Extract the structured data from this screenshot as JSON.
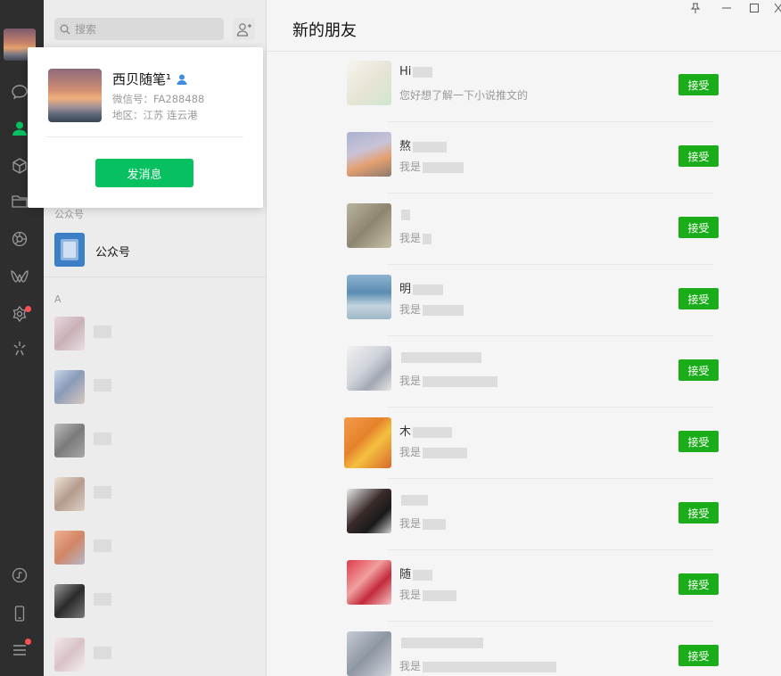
{
  "search": {
    "placeholder": "搜索"
  },
  "popup": {
    "name": "西贝随笔¹",
    "wechat_id": "微信号：FA288488",
    "region": "地区：江苏  连云港",
    "send_button": "发消息"
  },
  "contacts": {
    "official_section": "公众号",
    "official_label": "公众号",
    "a_section": "A"
  },
  "main": {
    "title": "新的朋友",
    "accept_label": "接受",
    "requests": [
      {
        "name": "Hi",
        "message": "您好想了解一下小说推文的"
      },
      {
        "name": "熬",
        "message": "我是"
      },
      {
        "name": "",
        "message": "我是"
      },
      {
        "name": "明",
        "message": "我是"
      },
      {
        "name": "",
        "message": "我是"
      },
      {
        "name": "木",
        "message": "我是"
      },
      {
        "name": "",
        "message": "我是"
      },
      {
        "name": "随",
        "message": "我是"
      },
      {
        "name": "",
        "message": "我是"
      }
    ]
  },
  "colors": {
    "accent": "#07c160",
    "accept": "#1aad19",
    "rail": "#2e2e2e",
    "badge": "#fa5151"
  }
}
